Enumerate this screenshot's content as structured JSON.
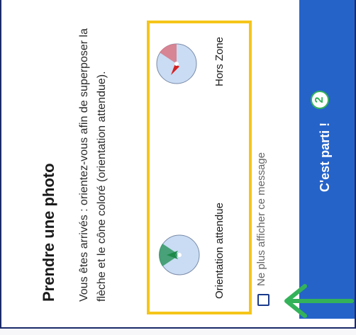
{
  "dialog": {
    "title": "Prendre une photo",
    "description": "Vous êtes arrivés : orientez-vous afin de superposer la flèche et le cône coloré (orientation attendue).",
    "examples": [
      {
        "label": "Orientation attendue",
        "icon": "compass-aligned-icon"
      },
      {
        "label": "Hors Zone",
        "icon": "compass-out-of-zone-icon"
      }
    ],
    "checkbox_label": "Ne plus afficher ce message",
    "cta_label": "C'est parti !",
    "step_badge": "2"
  },
  "colors": {
    "highlight_box": "#f5c518",
    "button": "#2563c9",
    "annotation_arrow": "#34b25a",
    "cone_green": "#3a9a6a",
    "cone_red": "#d87a8a",
    "arrow_red": "#d42020"
  }
}
